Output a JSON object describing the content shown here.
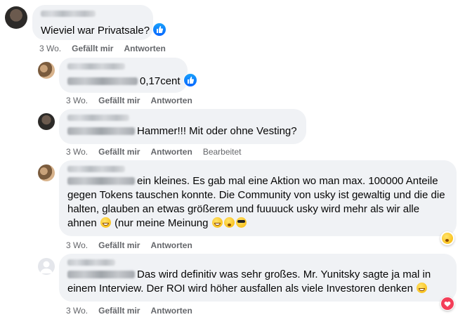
{
  "comments": [
    {
      "text": "Wieviel war Privatsale?",
      "time": "3 Wo.",
      "like_label": "Gefällt mir",
      "reply_label": "Antworten"
    },
    {
      "text": "0,17cent",
      "time": "3 Wo.",
      "like_label": "Gefällt mir",
      "reply_label": "Antworten"
    },
    {
      "text": "Hammer!!! Mit oder ohne Vesting?",
      "time": "3 Wo.",
      "like_label": "Gefällt mir",
      "reply_label": "Antworten",
      "edited_label": "Bearbeitet"
    },
    {
      "text_line1": "ein kleines. Es gab mal eine Aktion wo man max. 100000 Anteile",
      "text_line2": "gegen Tokens tauschen konnte. Die Community von usky ist gewaltig und die die",
      "text_line3": "halten, glauben an etwas größerem und fuuuuck usky wird mehr als wir alle",
      "text_line4a": "ahnen",
      "text_line4b": "(nur meine Meinung",
      "time": "3 Wo.",
      "like_label": "Gefällt mir",
      "reply_label": "Antworten",
      "reaction": "care-reaction"
    },
    {
      "text_line1": "Das wird definitiv was sehr großes. Mr. Yunitsky sagte ja mal in",
      "text_line2": "einem Interview. Der ROI wird höher ausfallen als viele Investoren denken",
      "time": "3 Wo.",
      "like_label": "Gefällt mir",
      "reply_label": "Antworten",
      "reaction": "love-reaction"
    }
  ],
  "colors": {
    "bubble": "#f0f2f5",
    "meta": "#65676b",
    "like_blue": "#0866ff",
    "love_red": "#f33e58"
  }
}
